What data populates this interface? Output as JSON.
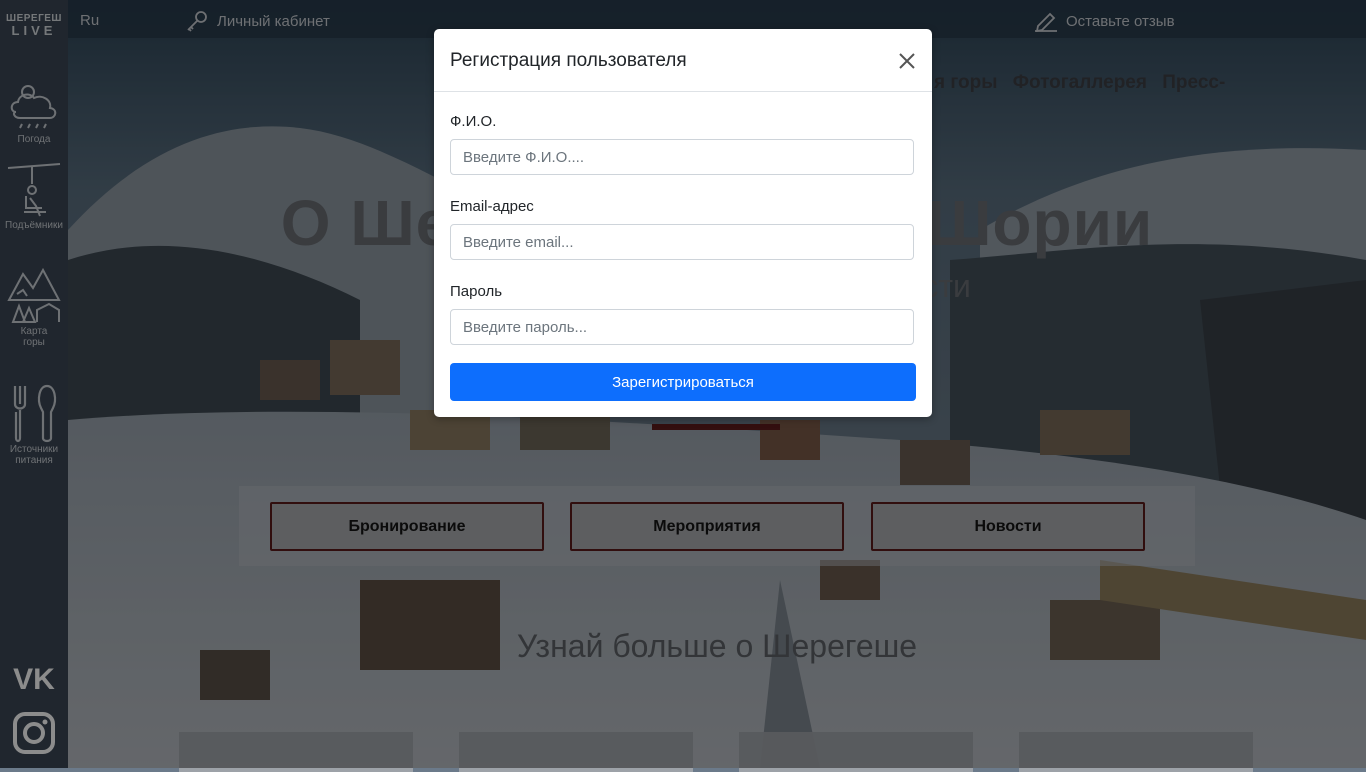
{
  "brand": {
    "line1": "ШЕРЕГЕШ",
    "line2": "LIVE"
  },
  "topbar": {
    "language": "Ru",
    "cabinet_label": "Личный кабинет",
    "review_label": "Оставьте отзыв"
  },
  "sidebar": {
    "items": [
      {
        "label": "Погода",
        "icon": "weather-icon"
      },
      {
        "label": "Подъёмники",
        "icon": "chairlift-icon"
      },
      {
        "label_line1": "Карта",
        "label_line2": "горы",
        "icon": "mountain-map-icon"
      },
      {
        "label_line1": "Источники",
        "label_line2": "питания",
        "icon": "food-icon"
      }
    ],
    "social": [
      "vk-icon",
      "instagram-icon"
    ]
  },
  "page": {
    "nav_items": [
      "я горы",
      "Фотогаллерея",
      "Пресс-"
    ],
    "hero_title": "О Шер                    й Шории",
    "hero_sub1": "Второ                              улярности",
    "hero_sub2": "и",
    "buttons": [
      "Бронирование",
      "Мероприятия",
      "Новости"
    ],
    "learn_more": "Узнай больше о Шерегеше"
  },
  "modal": {
    "title": "Регистрация пользователя",
    "fields": [
      {
        "label": "Ф.И.О.",
        "placeholder": "Введите Ф.И.О....",
        "value": ""
      },
      {
        "label": "Email-адрес",
        "placeholder": "Введите email...",
        "value": ""
      },
      {
        "label": "Пароль",
        "placeholder": "Введите пароль...",
        "value": ""
      }
    ],
    "submit_label": "Зарегистрироваться"
  },
  "colors": {
    "sidebar_bg": "#3b4654",
    "primary_button": "#0d6efd",
    "accent_red": "#5a1a1a"
  }
}
